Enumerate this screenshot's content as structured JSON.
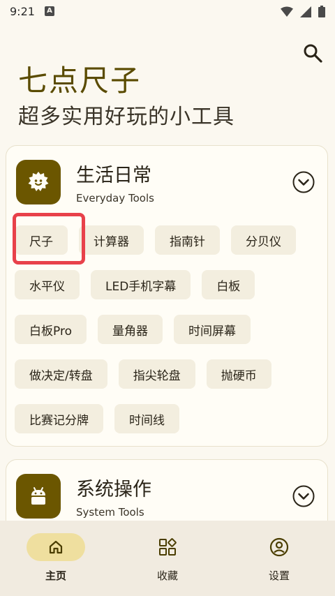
{
  "status_bar": {
    "time": "9:21",
    "notification_letter": "A"
  },
  "header": {
    "title": "七点尺子",
    "subtitle": "超多实用好玩的小工具"
  },
  "categories": [
    {
      "title": "生活日常",
      "subtitle": "Everyday Tools",
      "tools": [
        "尺子",
        "计算器",
        "指南针",
        "分贝仪",
        "水平仪",
        "LED手机字幕",
        "白板",
        "白板Pro",
        "量角器",
        "时间屏幕",
        "做决定/转盘",
        "指尖轮盘",
        "抛硬币",
        "比赛记分牌",
        "时间线"
      ]
    },
    {
      "title": "系统操作",
      "subtitle": "System Tools"
    }
  ],
  "bottom_nav": [
    {
      "label": "主页",
      "icon": "home-icon",
      "active": true
    },
    {
      "label": "收藏",
      "icon": "grid-favorites-icon",
      "active": false
    },
    {
      "label": "设置",
      "icon": "account-circle-icon",
      "active": false
    }
  ],
  "colors": {
    "accent": "#6b5600",
    "highlight": "#e8414a",
    "chip_bg": "#f3eedf",
    "nav_active": "#efdf9f"
  }
}
